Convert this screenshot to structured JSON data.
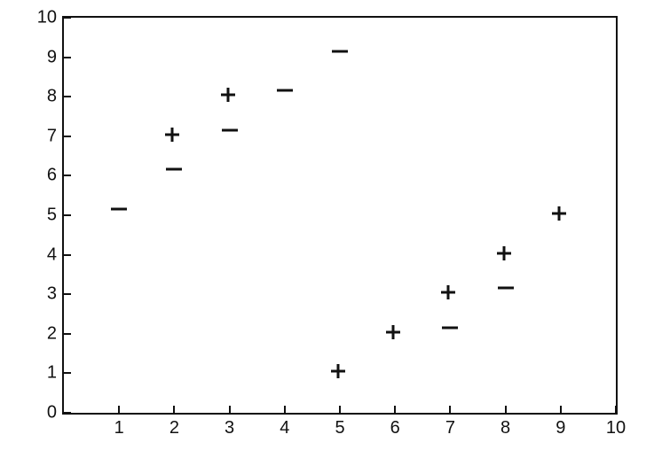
{
  "chart_data": {
    "type": "scatter",
    "xlim": [
      0,
      10
    ],
    "ylim": [
      0,
      10
    ],
    "xticks": [
      1,
      2,
      3,
      4,
      5,
      6,
      7,
      8,
      9,
      10
    ],
    "yticks": [
      0,
      1,
      2,
      3,
      4,
      5,
      6,
      7,
      8,
      9,
      10
    ],
    "title": "",
    "xlabel": "",
    "ylabel": "",
    "series": [
      {
        "name": "plus",
        "marker": "+",
        "points": [
          {
            "x": 2,
            "y": 7
          },
          {
            "x": 3,
            "y": 8
          },
          {
            "x": 5,
            "y": 1
          },
          {
            "x": 6,
            "y": 2
          },
          {
            "x": 7,
            "y": 3
          },
          {
            "x": 8,
            "y": 4
          },
          {
            "x": 9,
            "y": 5
          }
        ]
      },
      {
        "name": "minus",
        "marker": "-",
        "points": [
          {
            "x": 1,
            "y": 5
          },
          {
            "x": 2,
            "y": 6
          },
          {
            "x": 3,
            "y": 7
          },
          {
            "x": 4,
            "y": 8
          },
          {
            "x": 5,
            "y": 9
          },
          {
            "x": 7,
            "y": 2
          },
          {
            "x": 8,
            "y": 3
          }
        ]
      }
    ]
  }
}
